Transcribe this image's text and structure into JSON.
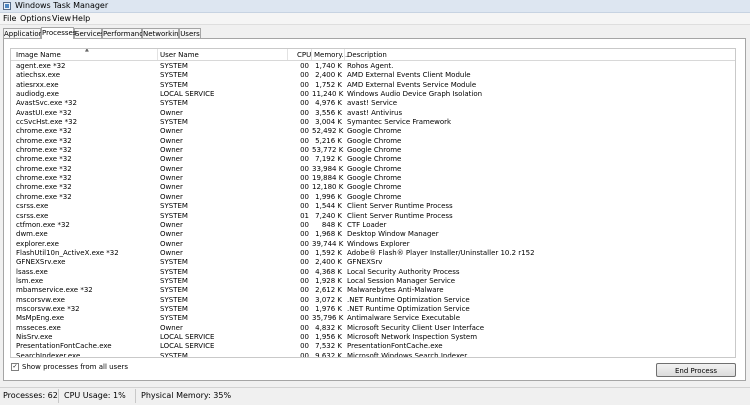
{
  "window": {
    "title": "Windows Task Manager"
  },
  "menu": [
    "File",
    "Options",
    "View",
    "Help"
  ],
  "tabs": [
    "Applications",
    "Processes",
    "Services",
    "Performance",
    "Networking",
    "Users"
  ],
  "active_tab": "Processes",
  "columns": {
    "name": "Image Name",
    "user": "User Name",
    "cpu": "CPU",
    "mem": "Memory...",
    "desc": "Description"
  },
  "processes": [
    {
      "name": "agent.exe *32",
      "user": "SYSTEM",
      "cpu": "00",
      "mem": "1,740 K",
      "desc": "Rohos Agent."
    },
    {
      "name": "atiechsx.exe",
      "user": "SYSTEM",
      "cpu": "00",
      "mem": "2,400 K",
      "desc": "AMD External Events Client Module"
    },
    {
      "name": "atiesrxx.exe",
      "user": "SYSTEM",
      "cpu": "00",
      "mem": "1,752 K",
      "desc": "AMD External Events Service Module"
    },
    {
      "name": "audiodg.exe",
      "user": "LOCAL SERVICE",
      "cpu": "00",
      "mem": "11,240 K",
      "desc": "Windows Audio Device Graph Isolation"
    },
    {
      "name": "AvastSvc.exe *32",
      "user": "SYSTEM",
      "cpu": "00",
      "mem": "4,976 K",
      "desc": "avast! Service"
    },
    {
      "name": "AvastUI.exe *32",
      "user": "Owner",
      "cpu": "00",
      "mem": "3,556 K",
      "desc": "avast! Antivirus"
    },
    {
      "name": "ccSvcHst.exe *32",
      "user": "SYSTEM",
      "cpu": "00",
      "mem": "3,004 K",
      "desc": "Symantec Service Framework"
    },
    {
      "name": "chrome.exe *32",
      "user": "Owner",
      "cpu": "00",
      "mem": "52,492 K",
      "desc": "Google Chrome"
    },
    {
      "name": "chrome.exe *32",
      "user": "Owner",
      "cpu": "00",
      "mem": "5,216 K",
      "desc": "Google Chrome"
    },
    {
      "name": "chrome.exe *32",
      "user": "Owner",
      "cpu": "00",
      "mem": "53,772 K",
      "desc": "Google Chrome"
    },
    {
      "name": "chrome.exe *32",
      "user": "Owner",
      "cpu": "00",
      "mem": "7,192 K",
      "desc": "Google Chrome"
    },
    {
      "name": "chrome.exe *32",
      "user": "Owner",
      "cpu": "00",
      "mem": "33,984 K",
      "desc": "Google Chrome"
    },
    {
      "name": "chrome.exe *32",
      "user": "Owner",
      "cpu": "00",
      "mem": "19,884 K",
      "desc": "Google Chrome"
    },
    {
      "name": "chrome.exe *32",
      "user": "Owner",
      "cpu": "00",
      "mem": "12,180 K",
      "desc": "Google Chrome"
    },
    {
      "name": "chrome.exe *32",
      "user": "Owner",
      "cpu": "00",
      "mem": "1,996 K",
      "desc": "Google Chrome"
    },
    {
      "name": "csrss.exe",
      "user": "SYSTEM",
      "cpu": "00",
      "mem": "1,544 K",
      "desc": "Client Server Runtime Process"
    },
    {
      "name": "csrss.exe",
      "user": "SYSTEM",
      "cpu": "01",
      "mem": "7,240 K",
      "desc": "Client Server Runtime Process"
    },
    {
      "name": "ctfmon.exe *32",
      "user": "Owner",
      "cpu": "00",
      "mem": "848 K",
      "desc": "CTF Loader"
    },
    {
      "name": "dwm.exe",
      "user": "Owner",
      "cpu": "00",
      "mem": "1,968 K",
      "desc": "Desktop Window Manager"
    },
    {
      "name": "explorer.exe",
      "user": "Owner",
      "cpu": "00",
      "mem": "39,744 K",
      "desc": "Windows Explorer"
    },
    {
      "name": "FlashUtil10n_ActiveX.exe *32",
      "user": "Owner",
      "cpu": "00",
      "mem": "1,592 K",
      "desc": "Adobe® Flash® Player Installer/Uninstaller 10.2 r152"
    },
    {
      "name": "GFNEXSrv.exe",
      "user": "SYSTEM",
      "cpu": "00",
      "mem": "2,400 K",
      "desc": "GFNEXSrv"
    },
    {
      "name": "lsass.exe",
      "user": "SYSTEM",
      "cpu": "00",
      "mem": "4,368 K",
      "desc": "Local Security Authority Process"
    },
    {
      "name": "lsm.exe",
      "user": "SYSTEM",
      "cpu": "00",
      "mem": "1,928 K",
      "desc": "Local Session Manager Service"
    },
    {
      "name": "mbamservice.exe *32",
      "user": "SYSTEM",
      "cpu": "00",
      "mem": "2,612 K",
      "desc": "Malwarebytes Anti-Malware"
    },
    {
      "name": "mscorsvw.exe",
      "user": "SYSTEM",
      "cpu": "00",
      "mem": "3,072 K",
      ".desc": "",
      "desc": ".NET Runtime Optimization Service"
    },
    {
      "name": "mscorsvw.exe *32",
      "user": "SYSTEM",
      "cpu": "00",
      "mem": "1,976 K",
      "desc": ".NET Runtime Optimization Service"
    },
    {
      "name": "MsMpEng.exe",
      "user": "SYSTEM",
      "cpu": "00",
      "mem": "35,796 K",
      "desc": "Antimalware Service Executable"
    },
    {
      "name": "msseces.exe",
      "user": "Owner",
      "cpu": "00",
      "mem": "4,832 K",
      "desc": "Microsoft Security Client User Interface"
    },
    {
      "name": "NisSrv.exe",
      "user": "LOCAL SERVICE",
      "cpu": "00",
      "mem": "1,956 K",
      "desc": "Microsoft Network Inspection System"
    },
    {
      "name": "PresentationFontCache.exe",
      "user": "LOCAL SERVICE",
      "cpu": "00",
      "mem": "7,532 K",
      "desc": "PresentationFontCache.exe"
    },
    {
      "name": "SearchIndexer.exe",
      "user": "SYSTEM",
      "cpu": "00",
      "mem": "9,632 K",
      "desc": "Microsoft Windows Search Indexer"
    }
  ],
  "show_all_label": "Show processes from all users",
  "show_all_checked": true,
  "end_process_label": "End Process",
  "status": {
    "processes": "Processes: 62",
    "cpu": "CPU Usage: 1%",
    "memory": "Physical Memory: 35%"
  }
}
